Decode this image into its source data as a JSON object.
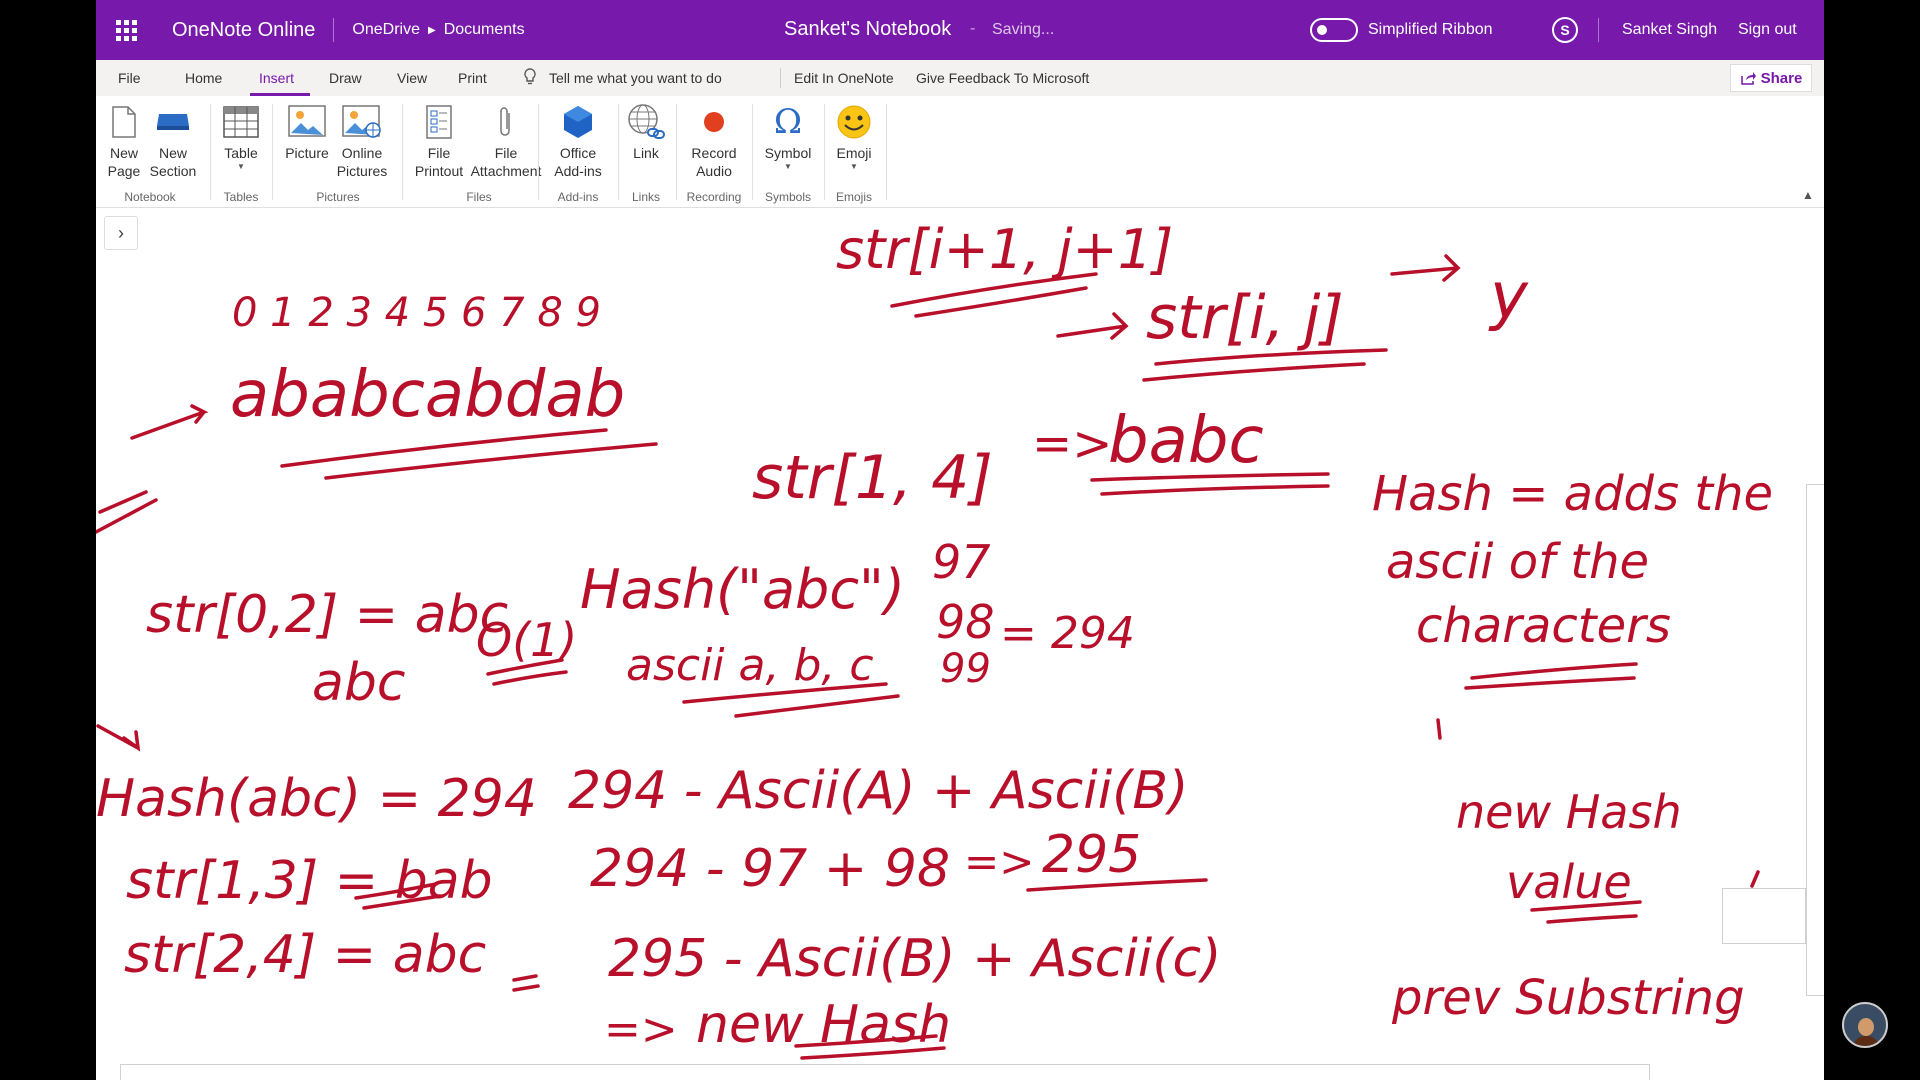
{
  "titlebar": {
    "app_name": "OneNote Online",
    "breadcrumb": [
      "OneDrive",
      "Documents"
    ],
    "notebook_title": "Sanket's Notebook",
    "separator": "-",
    "status": "Saving...",
    "toggle_label": "Simplified Ribbon",
    "user_name": "Sanket Singh",
    "sign_out": "Sign out"
  },
  "tabs": {
    "file": "File",
    "home": "Home",
    "insert": "Insert",
    "draw": "Draw",
    "view": "View",
    "print": "Print",
    "tell_me": "Tell me what you want to do",
    "edit_in_onenote": "Edit In OneNote",
    "feedback": "Give Feedback To Microsoft",
    "share": "Share",
    "active": "Insert"
  },
  "ribbon": {
    "buttons": {
      "new_page": [
        "New",
        "Page"
      ],
      "new_section": [
        "New",
        "Section"
      ],
      "table": "Table",
      "picture": "Picture",
      "online_pictures": [
        "Online",
        "Pictures"
      ],
      "file_printout": [
        "File",
        "Printout"
      ],
      "file_attachment": [
        "File",
        "Attachment"
      ],
      "office_addins": [
        "Office",
        "Add-ins"
      ],
      "link": "Link",
      "record_audio": [
        "Record",
        "Audio"
      ],
      "symbol": "Symbol",
      "emoji": "Emoji"
    },
    "groups": {
      "notebook": "Notebook",
      "tables": "Tables",
      "pictures": "Pictures",
      "files": "Files",
      "addins": "Add-ins",
      "links": "Links",
      "recording": "Recording",
      "symbols": "Symbols",
      "emojis": "Emojis"
    }
  },
  "handwriting": {
    "top_partial": "str[i+1, j+1]",
    "indices": "0 1 2 3 4 5 6 7 8 9",
    "string": "ababcabdab",
    "str_ij": "str[i, j]",
    "arrow_y": "y",
    "str_14": "str[1, 4]",
    "arrow_babc": "=>",
    "babc": "babc",
    "hash_rule_1": "Hash = adds the",
    "hash_rule_2": "ascii of the",
    "hash_rule_3": "characters",
    "str_02": "str[0,2] = abc",
    "o1": "O(1)",
    "hash_abc_call": "Hash(\"abc\")",
    "n97": "97",
    "n98": "98",
    "eq294": "= 294",
    "n99": "99",
    "abc_word": "abc",
    "ascii_abc": "ascii a, b, c",
    "hash_abc_eq": "Hash(abc) = 294",
    "calc1": "294 - Ascii(A) + Ascii(B)",
    "str_13": "str[1,3] = bab",
    "calc2": "294 - 97 + 98",
    "calc2_arrow": "=>",
    "result_295": "295",
    "new_hash_value_1": "new Hash",
    "new_hash_value_2": "value",
    "str_24": "str[2,4] = abc",
    "calc3": "295 - Ascii(B) + Ascii(c)",
    "arrow_new_hash": "=>",
    "new_hash": "new Hash",
    "prev_substring": "prev Substring"
  }
}
